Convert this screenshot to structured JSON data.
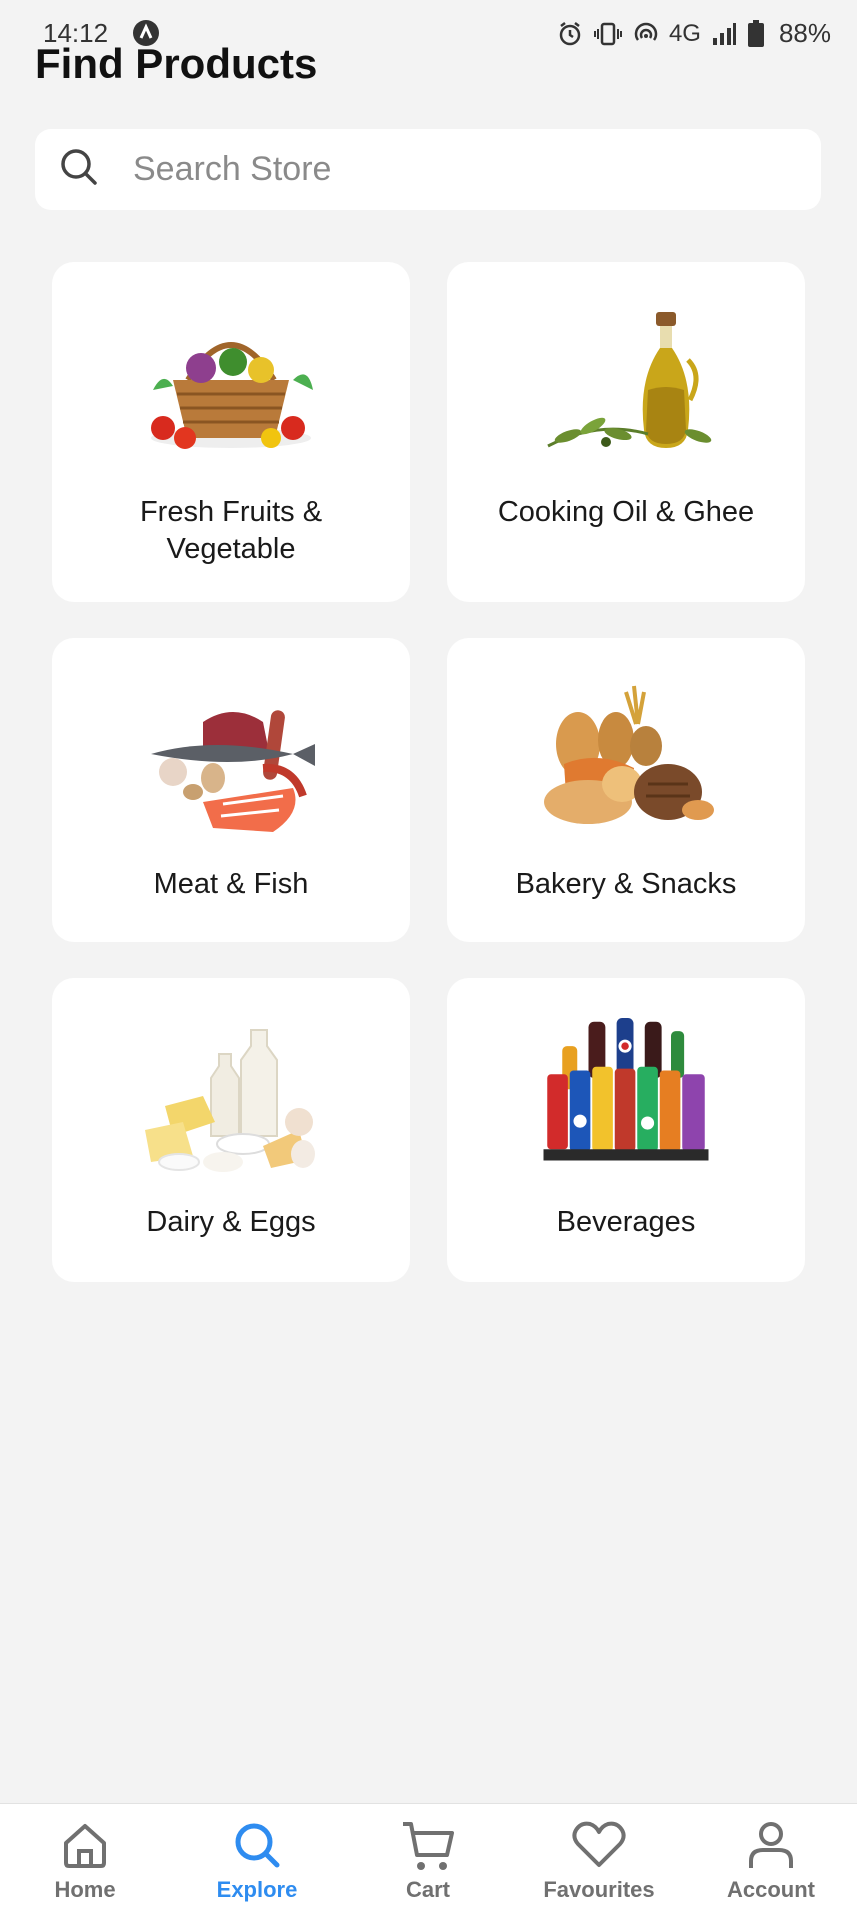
{
  "status": {
    "time": "14:12",
    "network": "4G",
    "battery": "88%"
  },
  "page": {
    "title": "Find Products"
  },
  "search": {
    "placeholder": "Search Store",
    "icon": "search-icon"
  },
  "categories": [
    {
      "label": "Fresh Fruits &\nVegetable",
      "image": "vegetable-basket-image"
    },
    {
      "label": "Cooking Oil & Ghee",
      "image": "olive-oil-bottle-image"
    },
    {
      "label": "Meat & Fish",
      "image": "meat-fish-image"
    },
    {
      "label": "Bakery & Snacks",
      "image": "bread-image"
    },
    {
      "label": "Dairy & Eggs",
      "image": "dairy-products-image"
    },
    {
      "label": "Beverages",
      "image": "soft-drinks-image"
    }
  ],
  "nav": {
    "items": [
      {
        "label": "Home",
        "icon": "home-icon",
        "active": false
      },
      {
        "label": "Explore",
        "icon": "search-icon",
        "active": true
      },
      {
        "label": "Cart",
        "icon": "cart-icon",
        "active": false
      },
      {
        "label": "Favourites",
        "icon": "heart-icon",
        "active": false
      },
      {
        "label": "Account",
        "icon": "user-icon",
        "active": false
      }
    ],
    "active_color": "#2e8cf0",
    "inactive_color": "#707070"
  }
}
